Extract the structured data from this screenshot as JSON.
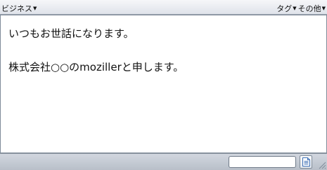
{
  "toolbar": {
    "business_label": "ビジネス",
    "tags_label": "タグ",
    "other_label": "その他"
  },
  "editor": {
    "line1": "いつもお世話になります。",
    "line2": "株式会社○○のmozillerと申します。"
  },
  "statusbar": {
    "field_value": "",
    "doc_icon": "document-icon"
  }
}
